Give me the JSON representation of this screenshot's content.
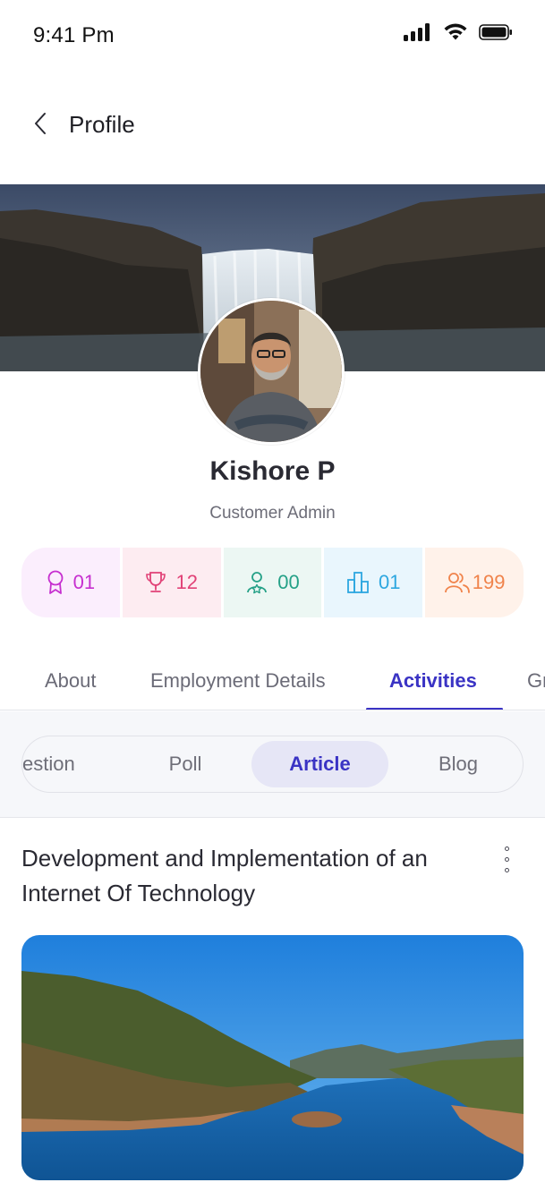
{
  "status_bar": {
    "time": "9:41 Pm",
    "icons": [
      "signal-icon",
      "wifi-icon",
      "battery-icon"
    ]
  },
  "header": {
    "back_icon": "chevron-left-icon",
    "title": "Profile"
  },
  "profile": {
    "name": "Kishore P",
    "role": "Customer Admin"
  },
  "stats": [
    {
      "icon": "award-icon",
      "value": "01",
      "color": "#c62fcf"
    },
    {
      "icon": "trophy-icon",
      "value": "12",
      "color": "#e14277"
    },
    {
      "icon": "user-star-icon",
      "value": "00",
      "color": "#25a187"
    },
    {
      "icon": "buildings-icon",
      "value": "01",
      "color": "#2da7e0"
    },
    {
      "icon": "users-icon",
      "value": "199",
      "color": "#f0834b"
    }
  ],
  "tabs": [
    {
      "label": "About",
      "active": false
    },
    {
      "label": "Employment Details",
      "active": false
    },
    {
      "label": "Activities",
      "active": true
    },
    {
      "label": "Gr",
      "active": false
    }
  ],
  "subtabs": [
    {
      "label": "estion",
      "active": false
    },
    {
      "label": "Poll",
      "active": false
    },
    {
      "label": "Article",
      "active": true
    },
    {
      "label": "Blog",
      "active": false
    }
  ],
  "post": {
    "title": "Development and Implementation of an Internet Of Technology",
    "menu_icon": "more-vertical-icon"
  },
  "colors": {
    "accent": "#3a33c4",
    "text": "#2a2a33",
    "muted": "#6d6d78"
  }
}
